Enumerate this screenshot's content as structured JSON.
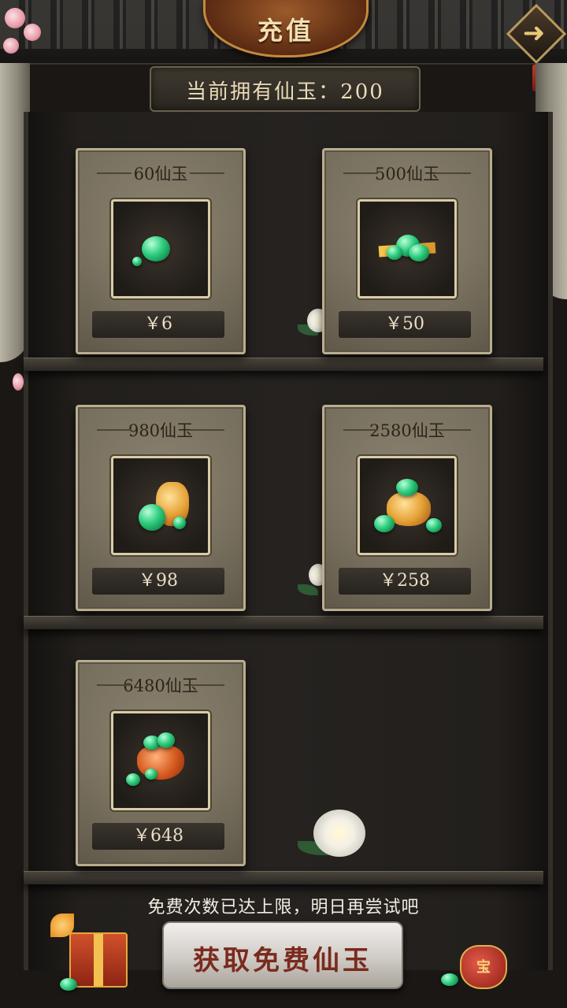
{
  "header": {
    "title": "充值",
    "next_icon": "arrow-right-icon"
  },
  "balance": {
    "label": "当前拥有仙玉：200"
  },
  "products": [
    {
      "name": "60仙玉",
      "price": "￥6",
      "icon": "jade-small-icon"
    },
    {
      "name": "500仙玉",
      "price": "￥50",
      "icon": "jade-pile-icon"
    },
    {
      "name": "980仙玉",
      "price": "￥98",
      "icon": "jade-pouch-icon"
    },
    {
      "name": "2580仙玉",
      "price": "￥258",
      "icon": "jade-treasure-bag-icon"
    },
    {
      "name": "6480仙玉",
      "price": "￥648",
      "icon": "jade-treasure-pot-icon"
    }
  ],
  "footer": {
    "notice": "免费次数已达上限，明日再尝试吧",
    "free_button": "获取免费仙玉",
    "treasure_label": "宝"
  }
}
